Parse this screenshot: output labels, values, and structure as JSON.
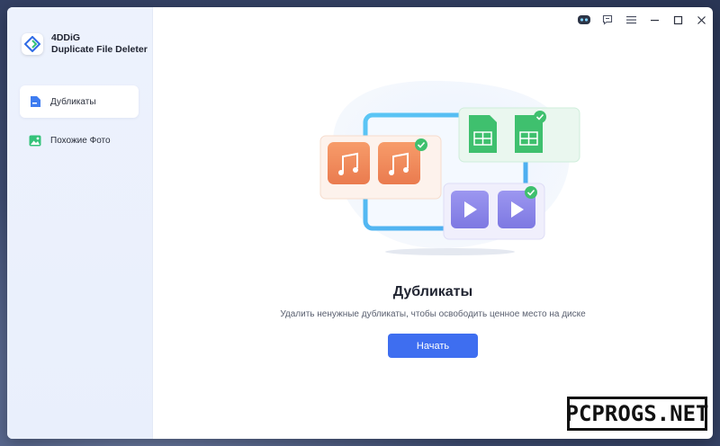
{
  "app": {
    "brand_line1": "4DDiG",
    "brand_line2": "Duplicate File Deleter"
  },
  "sidebar": {
    "items": [
      {
        "label": "Дубликаты",
        "icon": "file-icon",
        "active": true
      },
      {
        "label": "Похожие Фото",
        "icon": "image-icon",
        "active": false
      }
    ]
  },
  "titlebar": {
    "icons": [
      "bot-icon",
      "feedback-icon",
      "menu-icon",
      "minimize-icon",
      "maximize-icon",
      "close-icon"
    ]
  },
  "main": {
    "title": "Дубликаты",
    "subtitle": "Удалить ненужные дубликаты, чтобы освободить ценное место на диске",
    "start_label": "Начать"
  },
  "illustration": {
    "cards": [
      "music-files",
      "spreadsheet-files",
      "video-files"
    ]
  },
  "colors": {
    "accent": "#3e6ef0",
    "music": "#f0865a",
    "sheet": "#3fc06e",
    "video": "#8a86e8",
    "check": "#3fc06e"
  },
  "watermark": {
    "text": "PCPROGS.NET"
  }
}
